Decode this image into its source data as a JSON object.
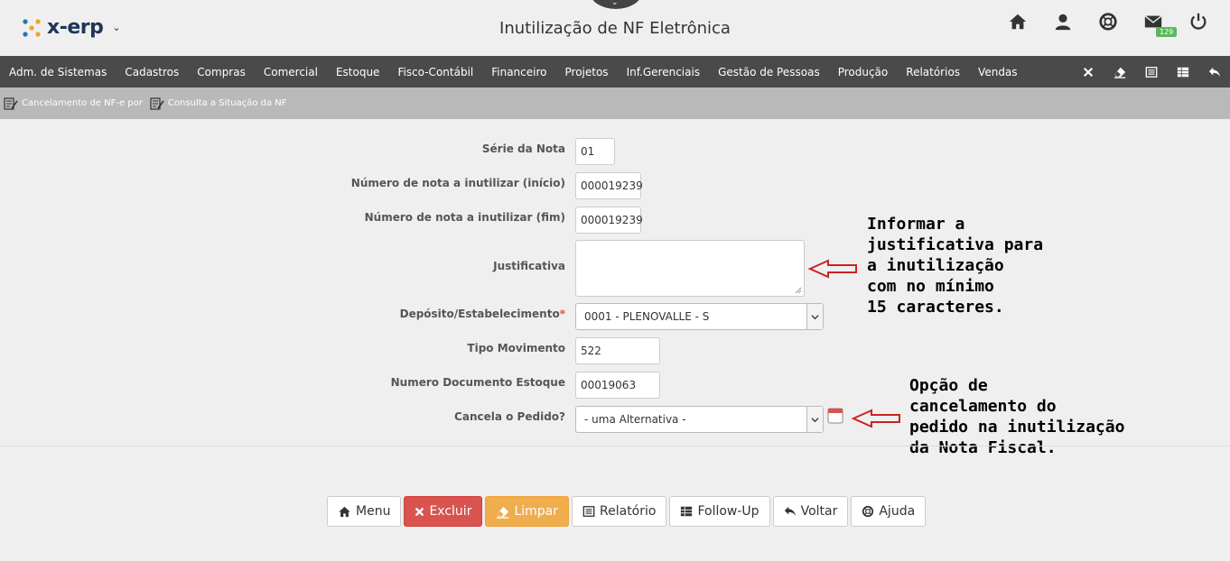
{
  "header": {
    "app_name": "x-erp",
    "page_title": "Inutilização de NF Eletrônica",
    "mail_badge": "129"
  },
  "menu": {
    "items": [
      "Adm. de Sistemas",
      "Cadastros",
      "Compras",
      "Comercial",
      "Estoque",
      "Fisco-Contábil",
      "Financeiro",
      "Projetos",
      "Inf.Gerenciais",
      "Gestão de Pessoas",
      "Produção",
      "Relatórios",
      "Vendas"
    ]
  },
  "sublinks": {
    "link1": "Cancelamento de NF-e por",
    "link2": "Consulta a Situação da NF"
  },
  "form": {
    "serie_label": "Série da Nota",
    "serie_value": "01",
    "inicio_label": "Número de nota a inutilizar (início)",
    "inicio_value": "000019239",
    "fim_label": "Número de nota a inutilizar (fim)",
    "fim_value": "000019239",
    "justificativa_label": "Justificativa",
    "justificativa_value": "",
    "deposito_label": "Depósito/Estabelecimento",
    "deposito_value": "0001 - PLENOVALLE - S",
    "tipo_label": "Tipo Movimento",
    "tipo_value": "522",
    "numdoc_label": "Numero Documento Estoque",
    "numdoc_value": "00019063",
    "cancela_label": "Cancela o Pedido?",
    "cancela_value": "- uma Alternativa -"
  },
  "annotations": {
    "justificativa": [
      "Informar a",
      "justificativa para",
      "a inutilização",
      "com no mínimo",
      "15 caracteres."
    ],
    "cancela": [
      "Opção de",
      "cancelamento do",
      "pedido na inutilização",
      "da Nota Fiscal."
    ]
  },
  "actions": {
    "menu": "Menu",
    "excluir": "Excluir",
    "limpar": "Limpar",
    "relatorio": "Relatório",
    "followup": "Follow-Up",
    "voltar": "Voltar",
    "ajuda": "Ajuda"
  },
  "colors": {
    "navbar": "#4a4a4a",
    "subbar": "#b9b9b9",
    "danger": "#d9534f",
    "warning": "#f0ad4e",
    "badge": "#5cb85c",
    "arrow": "#cc2222"
  }
}
